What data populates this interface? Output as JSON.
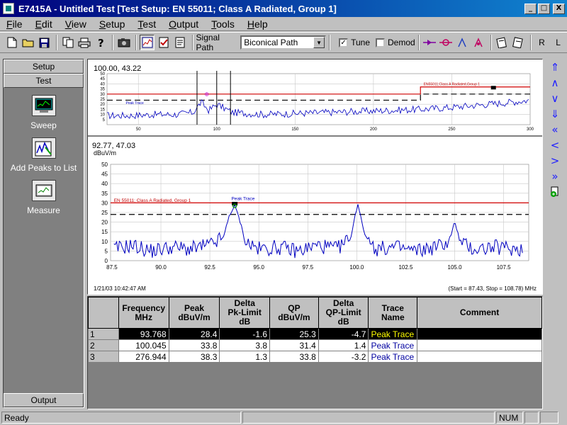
{
  "window": {
    "title": "E7415A - Untitled Test [Test Setup: EN 55011; Class A Radiated, Group 1]",
    "min_glyph": "_",
    "max_glyph": "□",
    "close_glyph": "X"
  },
  "menu": [
    "File",
    "Edit",
    "View",
    "Setup",
    "Test",
    "Output",
    "Tools",
    "Help"
  ],
  "toolbar": {
    "signal_path_label": "Signal Path",
    "signal_path_value": "Biconical Path",
    "tune_label": "Tune",
    "tune_checked": true,
    "demod_label": "Demod",
    "demod_checked": false,
    "r_label": "R",
    "l_label": "L"
  },
  "sidebar": {
    "setup_label": "Setup",
    "test_label": "Test",
    "sweep_label": "Sweep",
    "add_peaks_label": "Add Peaks to List",
    "measure_label": "Measure",
    "output_label": "Output"
  },
  "overview": {
    "readout": "100.00, 43.22",
    "limit_label": "EN55011;Class A Radiated,Group 1",
    "trace_label": "Peak Trace"
  },
  "main_plot": {
    "readout": "92.77, 47.03",
    "unit": "dBuV/m",
    "limit_label": "EN 55011; Class A Radiated, Group 1",
    "trace_label": "Peak Trace",
    "timestamp": "1/21/03 10:42:47 AM",
    "range_text": "(Start = 87.43, Stop = 108.78) MHz"
  },
  "chart_data": [
    {
      "type": "line",
      "name": "overview",
      "xlim": [
        30,
        300
      ],
      "ylim": [
        0,
        50
      ],
      "xticks": [
        50,
        100,
        150,
        200,
        250,
        300
      ],
      "yticks": [
        5,
        10,
        15,
        20,
        25,
        30,
        35,
        40,
        45,
        50
      ],
      "series": [
        {
          "name": "Peak Trace",
          "x": [
            30,
            45,
            60,
            75,
            85,
            90,
            95,
            100,
            110,
            130,
            150,
            170,
            190,
            210,
            230,
            250,
            265,
            280,
            300
          ],
          "y": [
            9,
            9,
            10,
            10,
            12,
            22,
            14,
            20,
            12,
            10,
            11,
            12,
            13,
            14,
            15,
            17,
            19,
            21,
            24
          ]
        }
      ],
      "limit_lines": [
        {
          "x": [
            30,
            230,
            230,
            300
          ],
          "y": [
            30,
            30,
            37,
            37
          ],
          "style": "solid"
        },
        {
          "x": [
            30,
            230,
            230,
            300
          ],
          "y": [
            24,
            24,
            30,
            30
          ],
          "style": "dashed"
        }
      ]
    },
    {
      "type": "line",
      "name": "main",
      "xlim": [
        87.43,
        108.78
      ],
      "ylim": [
        0,
        50
      ],
      "xticks": [
        87.5,
        90.0,
        92.5,
        95.0,
        97.5,
        100.0,
        102.5,
        105.0,
        107.5
      ],
      "yticks": [
        0,
        5,
        10,
        15,
        20,
        25,
        30,
        35,
        40,
        45,
        50
      ],
      "series": [
        {
          "name": "Peak Trace",
          "x": [
            87.6,
            88.5,
            89.5,
            90.5,
            91.5,
            92.5,
            93.2,
            93.5,
            93.77,
            94.0,
            94.3,
            95.0,
            96.0,
            97.0,
            98.0,
            99.0,
            99.7,
            100.05,
            100.4,
            101.0,
            102.0,
            103.0,
            104.0,
            104.7,
            105.0,
            105.3,
            106.0,
            107.0,
            108.5
          ],
          "y": [
            6,
            8,
            5,
            7,
            6,
            8,
            12,
            24,
            28.4,
            22,
            10,
            6,
            7,
            5,
            8,
            6,
            12,
            30,
            14,
            6,
            7,
            5,
            7,
            10,
            20,
            9,
            6,
            7,
            6
          ]
        }
      ],
      "limit_lines": [
        {
          "x": [
            87.43,
            108.78
          ],
          "y": [
            30,
            30
          ],
          "style": "solid"
        },
        {
          "x": [
            87.43,
            108.78
          ],
          "y": [
            24,
            24
          ],
          "style": "dashed"
        }
      ]
    }
  ],
  "table": {
    "headers": [
      {
        "l1": "Frequency",
        "l2": "MHz",
        "l3": ""
      },
      {
        "l1": "Peak",
        "l2": "dBuV/m",
        "l3": ""
      },
      {
        "l1": "Delta",
        "l2": "Pk-Limit",
        "l3": "dB"
      },
      {
        "l1": "QP",
        "l2": "dBuV/m",
        "l3": ""
      },
      {
        "l1": "Delta",
        "l2": "QP-Limit",
        "l3": "dB"
      },
      {
        "l1": "Trace",
        "l2": "Name",
        "l3": ""
      },
      {
        "l1": "Comment",
        "l2": "",
        "l3": ""
      }
    ],
    "rows": [
      {
        "idx": "1",
        "freq": "93.768",
        "peak": "28.4",
        "dpk": "-1.6",
        "qp": "25.3",
        "dqp": "-4.7",
        "trace": "Peak Trace",
        "comment": ""
      },
      {
        "idx": "2",
        "freq": "100.045",
        "peak": "33.8",
        "dpk": "3.8",
        "qp": "31.4",
        "dqp": "1.4",
        "trace": "Peak Trace",
        "comment": ""
      },
      {
        "idx": "3",
        "freq": "276.944",
        "peak": "38.3",
        "dpk": "1.3",
        "qp": "33.8",
        "dqp": "-3.2",
        "trace": "Peak Trace",
        "comment": ""
      }
    ]
  },
  "status": {
    "ready": "Ready",
    "num": "NUM"
  }
}
